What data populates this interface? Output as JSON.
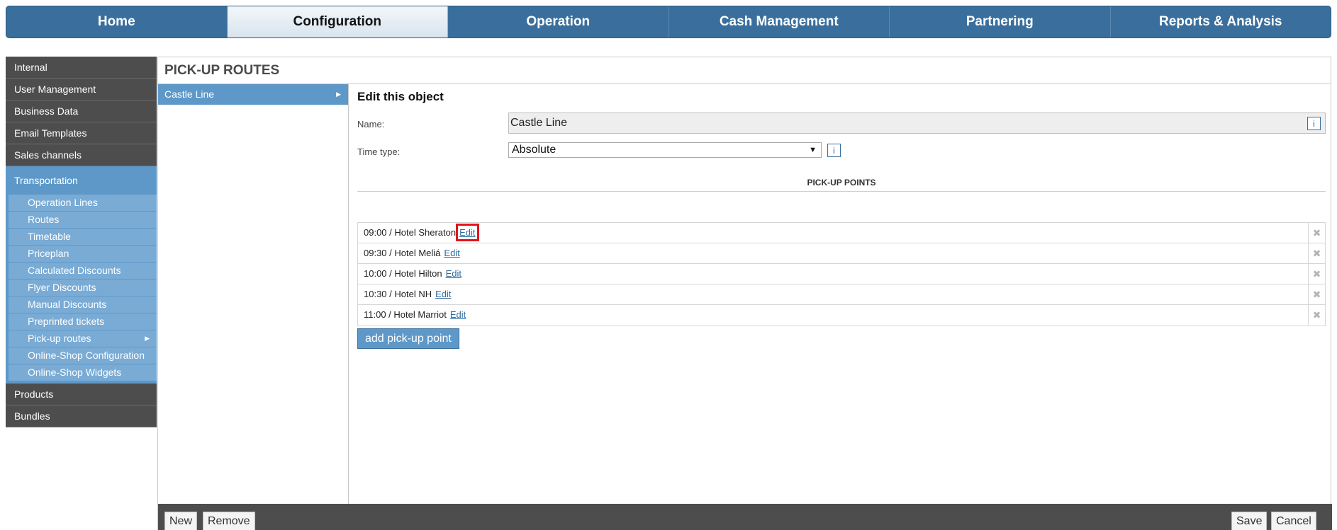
{
  "topnav": {
    "tabs": [
      {
        "label": "Home"
      },
      {
        "label": "Configuration"
      },
      {
        "label": "Operation"
      },
      {
        "label": "Cash Management"
      },
      {
        "label": "Partnering"
      },
      {
        "label": "Reports & Analysis"
      }
    ],
    "active": "Configuration"
  },
  "sidebar": {
    "items_top": [
      "Internal",
      "User Management",
      "Business Data",
      "Email Templates",
      "Sales channels"
    ],
    "active_section": "Transportation",
    "sub_items": [
      "Operation Lines",
      "Routes",
      "Timetable",
      "Priceplan",
      "Calculated Discounts",
      "Flyer Discounts",
      "Manual Discounts",
      "Preprinted tickets",
      "Pick-up routes",
      "Online-Shop Configuration",
      "Online-Shop Widgets"
    ],
    "items_bottom": [
      "Products",
      "Bundles"
    ],
    "active_sub": "Pick-up routes"
  },
  "main": {
    "title": "PICK-UP ROUTES",
    "list": [
      {
        "label": "Castle Line"
      }
    ],
    "edit": {
      "heading": "Edit this object",
      "name_label": "Name:",
      "name_value": "Castle Line",
      "time_type_label": "Time type:",
      "time_type_value": "Absolute",
      "info_glyph": "i",
      "section_title": "PICK-UP POINTS",
      "points": [
        {
          "text": "09:00 / Hotel Sheraton",
          "edit": "Edit"
        },
        {
          "text": "09:30 / Hotel Meliá",
          "edit": "Edit"
        },
        {
          "text": "10:00 / Hotel Hilton",
          "edit": "Edit"
        },
        {
          "text": "10:30 / Hotel NH",
          "edit": "Edit"
        },
        {
          "text": "11:00 / Hotel Marriot",
          "edit": "Edit"
        }
      ],
      "add_button": "add pick-up point"
    }
  },
  "footer": {
    "new": "New",
    "remove": "Remove",
    "save": "Save",
    "cancel": "Cancel"
  },
  "icons": {
    "delete": "close-icon",
    "arrow": "chevron-right-icon",
    "select_caret": "chevron-down-icon"
  },
  "colors": {
    "nav_blue": "#3a6f9d",
    "accent_blue": "#5d98c9",
    "sidebar_dark": "#4d4d4d",
    "highlight_red": "#e2141c"
  }
}
